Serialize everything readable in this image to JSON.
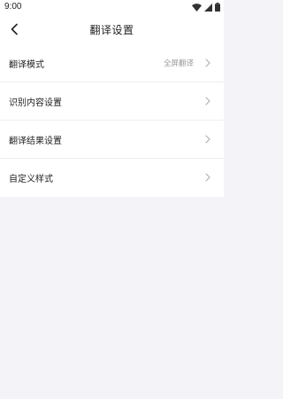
{
  "status_bar": {
    "time": "9:00",
    "icons": [
      "wifi-icon",
      "signal-icon",
      "battery-icon"
    ]
  },
  "header": {
    "title": "翻译设置",
    "back_icon": "chevron-left-icon"
  },
  "settings": {
    "items": [
      {
        "label": "翻译模式",
        "value": "全屏翻译"
      },
      {
        "label": "识别内容设置",
        "value": ""
      },
      {
        "label": "翻译结果设置",
        "value": ""
      },
      {
        "label": "自定义样式",
        "value": ""
      }
    ]
  },
  "colors": {
    "background": "#f4f4f8",
    "card": "#ffffff",
    "text": "#222222",
    "secondary_text": "#999999",
    "divider": "#eeeeee"
  }
}
